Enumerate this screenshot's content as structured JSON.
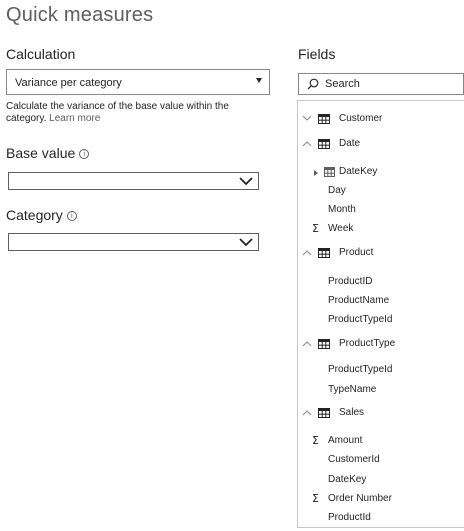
{
  "page": {
    "title": "Quick measures"
  },
  "calculation": {
    "label": "Calculation",
    "selected": "Variance per category",
    "description": "Calculate the variance of the base value within the category.",
    "learn_more": "Learn more"
  },
  "base_value": {
    "label": "Base value",
    "info_glyph": "i"
  },
  "category": {
    "label": "Category",
    "info_glyph": "i"
  },
  "fields": {
    "label": "Fields",
    "search_placeholder": "Search",
    "customer": "Customer",
    "date": {
      "name": "Date",
      "datekey": "DateKey",
      "day": "Day",
      "month": "Month",
      "week": "Week"
    },
    "product": {
      "name": "Product",
      "productid": "ProductID",
      "productname": "ProductName",
      "producttypeid": "ProductTypeId"
    },
    "producttype": {
      "name": "ProductType",
      "producttypeid": "ProductTypeId",
      "typename": "TypeName"
    },
    "sales": {
      "name": "Sales",
      "amount": "Amount",
      "customerid": "CustomerId",
      "datekey": "DateKey",
      "ordernumber": "Order Number",
      "productid": "ProductId"
    },
    "sigma_glyph": "Σ"
  }
}
